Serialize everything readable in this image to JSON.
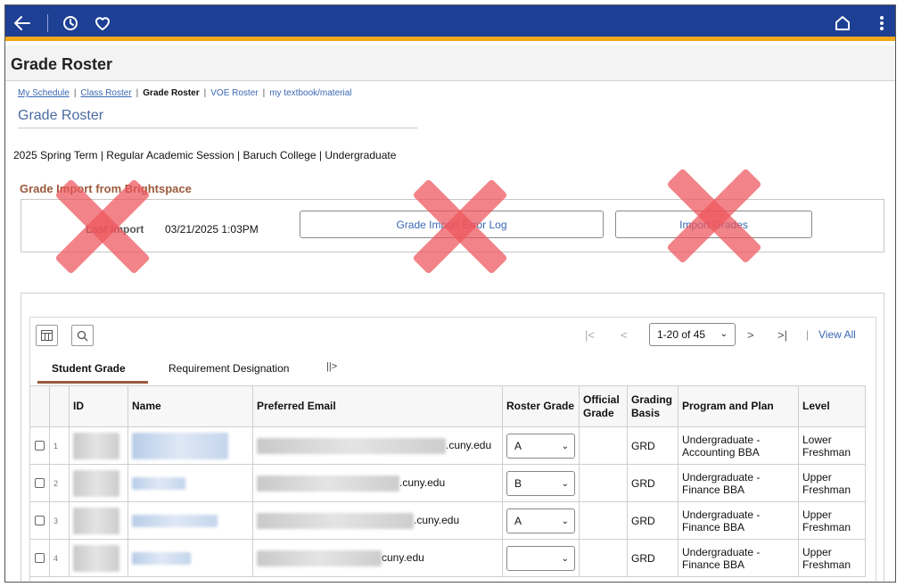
{
  "header": {
    "back_icon": "arrow-left-icon",
    "history_icon": "clock-icon",
    "favorites_icon": "heart-icon",
    "home_icon": "home-icon",
    "menu_icon": "kebab-menu-icon",
    "bar_color": "#1d3f94",
    "accent_color": "#f2a81d"
  },
  "page_header": {
    "title": "Grade Roster"
  },
  "breadcrumb": {
    "items": [
      "My Schedule",
      "Class Roster",
      "Grade Roster",
      "VOE Roster",
      "my textbook/material"
    ],
    "separator": "|"
  },
  "page_title": "Grade Roster",
  "term_info": "2025 Spring Term | Regular Academic Session | Baruch College | Undergraduate",
  "import_section": {
    "heading": "Grade Import from Brightspace",
    "last_import_label": "Last Import",
    "last_import_value": "03/21/2025  1:03PM",
    "error_log_button": "Grade Import Error Log",
    "import_button": "Import Grades",
    "x_mark_color": "#ed545b"
  },
  "grid_toolbar": {
    "columns_icon": "grid-columns-icon",
    "search_icon": "search-icon",
    "first_icon": "first-page-icon",
    "prev_icon": "previous-page-icon",
    "page_range": "1-20 of 45",
    "next_icon": "next-page-icon",
    "last_icon": "last-page-icon",
    "view_all": "View All"
  },
  "tabs": [
    {
      "label": "Student Grade",
      "active": true
    },
    {
      "label": "Requirement Designation",
      "active": false
    }
  ],
  "tab_more_icon": "show-all-columns-icon",
  "table": {
    "columns": [
      "ID",
      "Name",
      "Preferred Email",
      "Roster Grade",
      "Official Grade",
      "Grading Basis",
      "Program and Plan",
      "Level"
    ],
    "rows": [
      {
        "num": "1",
        "email_suffix": ".cuny.edu",
        "roster_grade": "A",
        "official_grade": "",
        "grading_basis": "GRD",
        "program_plan": "Undergraduate - Accounting BBA",
        "level": "Lower Freshman"
      },
      {
        "num": "2",
        "email_suffix": ".cuny.edu",
        "roster_grade": "B",
        "official_grade": "",
        "grading_basis": "GRD",
        "program_plan": "Undergraduate - Finance BBA",
        "level": "Upper Freshman"
      },
      {
        "num": "3",
        "email_suffix": ".cuny.edu",
        "roster_grade": "A",
        "official_grade": "",
        "grading_basis": "GRD",
        "program_plan": "Undergraduate - Finance BBA",
        "level": "Upper Freshman"
      },
      {
        "num": "4",
        "email_suffix": "cuny.edu",
        "roster_grade": "",
        "official_grade": "",
        "grading_basis": "GRD",
        "program_plan": "Undergraduate - Finance BBA",
        "level": "Upper Freshman"
      }
    ]
  }
}
